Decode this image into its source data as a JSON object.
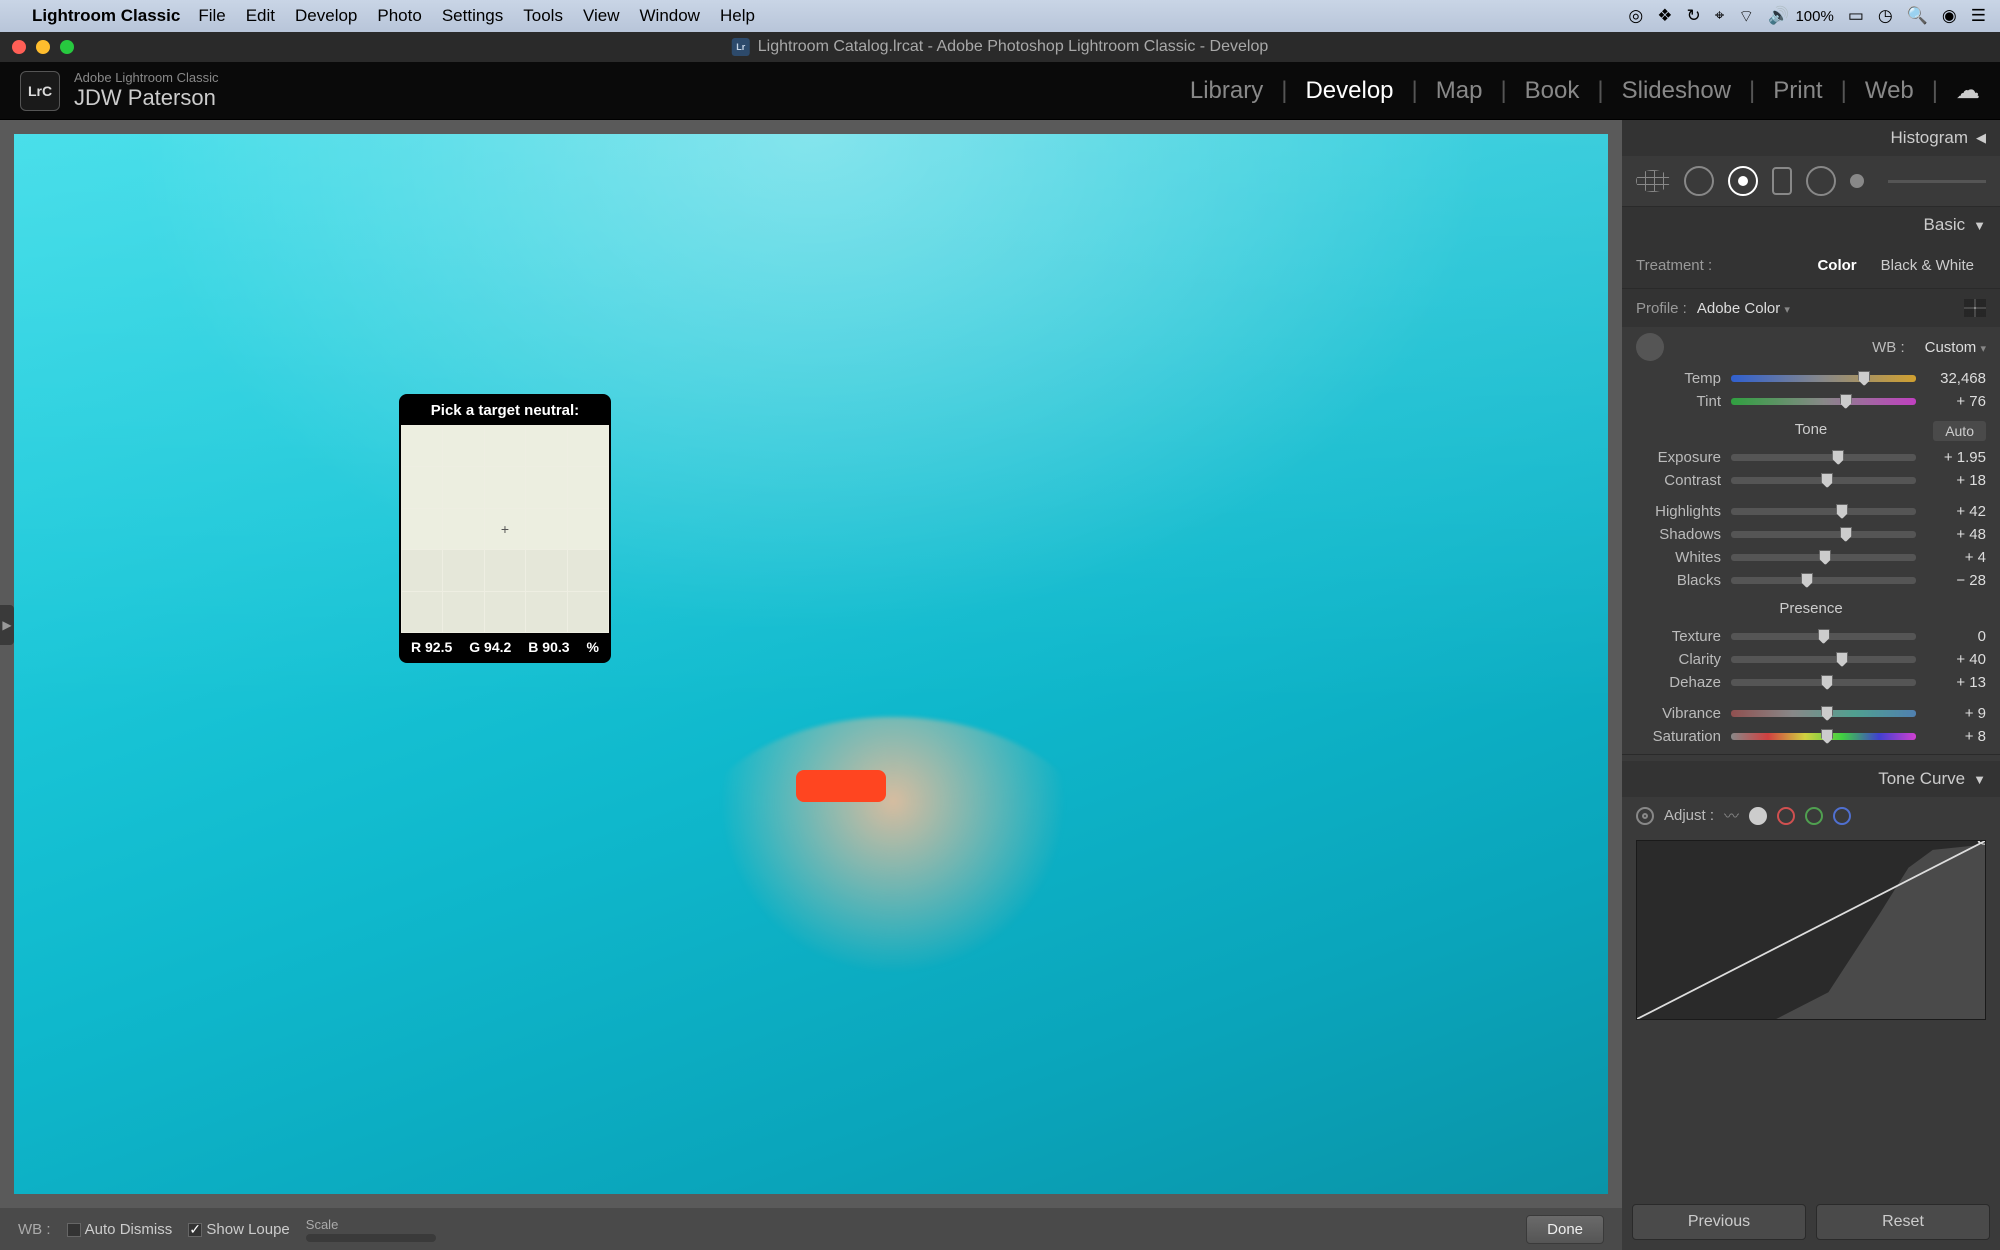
{
  "menubar": {
    "app": "Lightroom Classic",
    "items": [
      "File",
      "Edit",
      "Develop",
      "Photo",
      "Settings",
      "Tools",
      "View",
      "Window",
      "Help"
    ],
    "battery": "100%"
  },
  "window": {
    "title": "Lightroom Catalog.lrcat - Adobe Photoshop Lightroom Classic - Develop"
  },
  "header": {
    "brand_small": "Adobe Lightroom Classic",
    "brand_large": "JDW Paterson",
    "modules": [
      "Library",
      "Develop",
      "Map",
      "Book",
      "Slideshow",
      "Print",
      "Web"
    ],
    "active_module": "Develop"
  },
  "loupe": {
    "title": "Pick a target neutral:",
    "r_label": "R",
    "r": "92.5",
    "g_label": "G",
    "g": "94.2",
    "b_label": "B",
    "b": "90.3",
    "unit": "%"
  },
  "toolbar": {
    "wb_label": "WB :",
    "auto_dismiss": "Auto Dismiss",
    "show_loupe": "Show Loupe",
    "scale_label": "Scale",
    "done": "Done"
  },
  "panel": {
    "histogram": "Histogram",
    "basic": "Basic",
    "treatment_label": "Treatment :",
    "color": "Color",
    "bw": "Black & White",
    "profile_label": "Profile :",
    "profile_value": "Adobe Color",
    "wb_label": "WB :",
    "wb_value": "Custom",
    "tone_heading": "Tone",
    "auto": "Auto",
    "presence_heading": "Presence",
    "tone_curve": "Tone Curve",
    "adjust_label": "Adjust :",
    "previous": "Previous",
    "reset": "Reset",
    "sliders": {
      "temp": {
        "label": "Temp",
        "value": "32,468",
        "pos": 72
      },
      "tint": {
        "label": "Tint",
        "value": "+ 76",
        "pos": 62
      },
      "exposure": {
        "label": "Exposure",
        "value": "+ 1.95",
        "pos": 58
      },
      "contrast": {
        "label": "Contrast",
        "value": "+ 18",
        "pos": 52
      },
      "highlights": {
        "label": "Highlights",
        "value": "+ 42",
        "pos": 60
      },
      "shadows": {
        "label": "Shadows",
        "value": "+ 48",
        "pos": 62
      },
      "whites": {
        "label": "Whites",
        "value": "+ 4",
        "pos": 51
      },
      "blacks": {
        "label": "Blacks",
        "value": "− 28",
        "pos": 41
      },
      "texture": {
        "label": "Texture",
        "value": "0",
        "pos": 50
      },
      "clarity": {
        "label": "Clarity",
        "value": "+ 40",
        "pos": 60
      },
      "dehaze": {
        "label": "Dehaze",
        "value": "+ 13",
        "pos": 52
      },
      "vibrance": {
        "label": "Vibrance",
        "value": "+ 9",
        "pos": 52
      },
      "saturation": {
        "label": "Saturation",
        "value": "+ 8",
        "pos": 52
      }
    }
  }
}
